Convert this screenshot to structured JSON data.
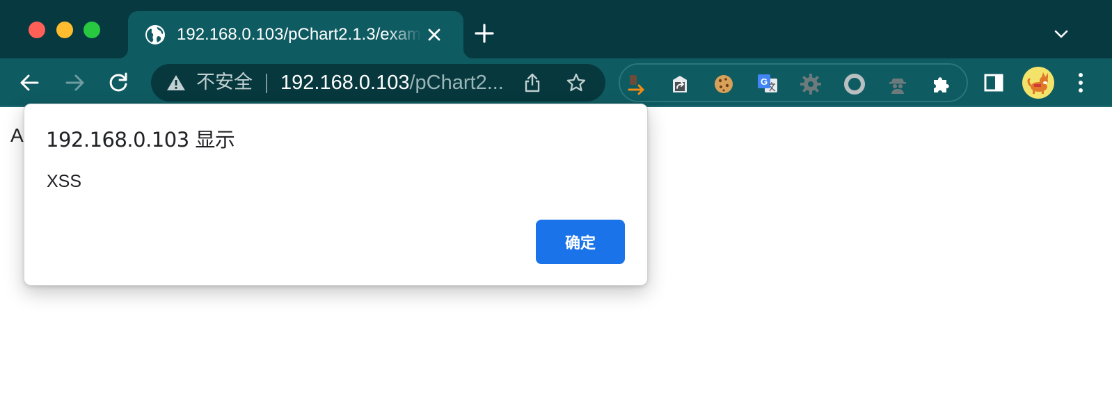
{
  "window": {
    "traffic_lights": [
      "close",
      "minimize",
      "maximize"
    ]
  },
  "tab": {
    "title": "192.168.0.103/pChart2.1.3/exam",
    "favicon": "globe-icon"
  },
  "toolbar": {
    "security_label": "不安全",
    "url_host": "192.168.0.103",
    "url_path": "/pChart2...",
    "extensions": [
      "pinned-extension-icon",
      "share-extension-icon",
      "cookie-icon",
      "google-translate-icon",
      "gear-extension-icon",
      "circle-extension-icon",
      "incognito-agent-icon",
      "extensions-puzzle-icon"
    ]
  },
  "page": {
    "body_text": "A"
  },
  "dialog": {
    "title": "192.168.0.103 显示",
    "message": "XSS",
    "ok_label": "确定"
  },
  "colors": {
    "tabstrip": "#063a40",
    "toolbar": "#0f5b62",
    "omnibox": "#06383d",
    "accent_button": "#1a73e8"
  }
}
